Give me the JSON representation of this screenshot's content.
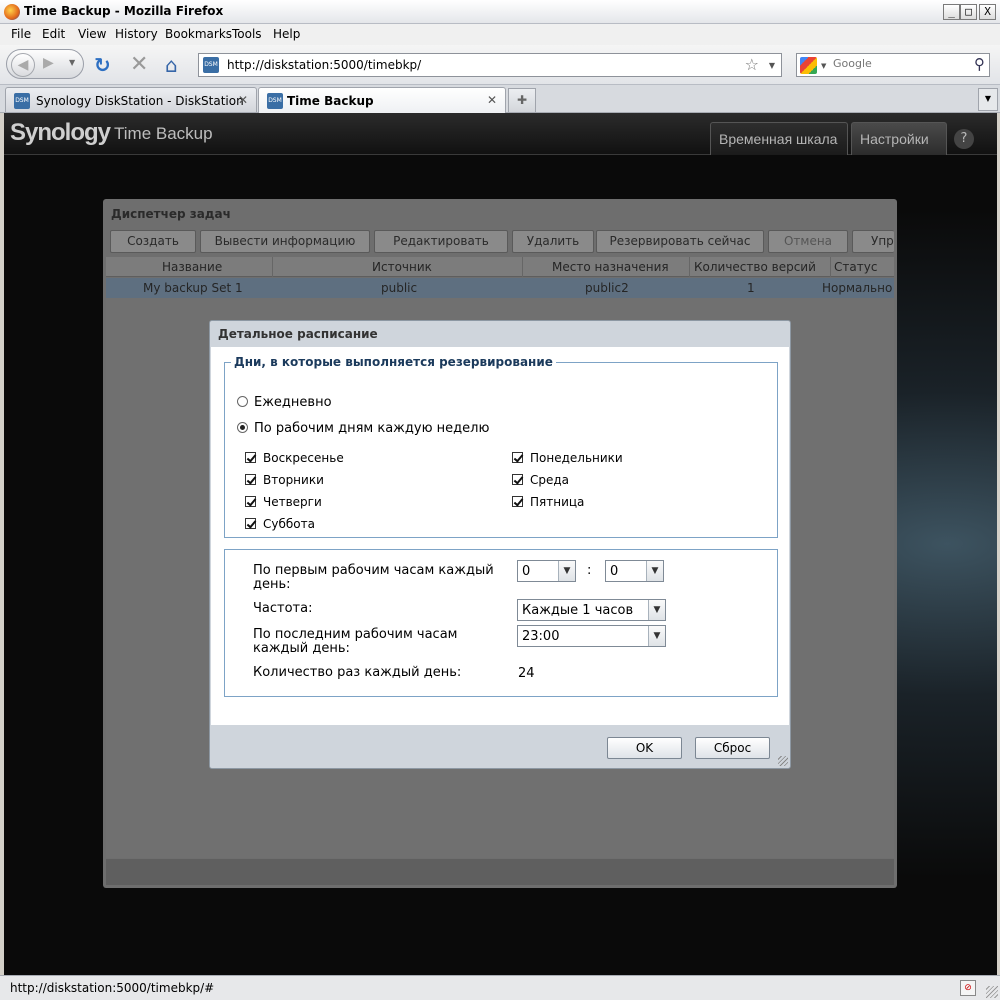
{
  "window": {
    "title": "Time Backup - Mozilla Firefox",
    "minimize": "_",
    "maximize": "□",
    "close": "X"
  },
  "menu": [
    "File",
    "Edit",
    "View",
    "History",
    "Bookmarks",
    "Tools",
    "Help"
  ],
  "nav": {
    "url": "http://diskstation:5000/timebkp/",
    "search_placeholder": "Google",
    "favicon_text": "DSM"
  },
  "tabs": [
    {
      "label": "Synology DiskStation - DiskStation",
      "active": false
    },
    {
      "label": "Time Backup",
      "active": true
    }
  ],
  "app": {
    "brand": "Synology",
    "name": "Time Backup",
    "tabs": [
      "Временная шкала",
      "Настройки"
    ],
    "help": "?"
  },
  "task_manager": {
    "title": "Диспетчер задач",
    "buttons": [
      "Создать",
      "Вывести информацию",
      "Редактировать",
      "Удалить",
      "Резервировать сейчас",
      "Отмена",
      "Упра"
    ],
    "columns": [
      "Название",
      "Источник",
      "Место назначения",
      "Количество версий",
      "Статус"
    ],
    "rows": [
      {
        "name": "My backup Set 1",
        "source": "public",
        "dest": "public2",
        "versions": "1",
        "status": "Нормально"
      }
    ]
  },
  "dialog": {
    "title": "Детальное расписание",
    "days_legend": "Дни, в которые выполняется резервирование",
    "radio_daily": "Ежедневно",
    "radio_weekdays": "По рабочим дням каждую неделю",
    "days": {
      "sun": "Воскресенье",
      "tue": "Вторники",
      "thu": "Четверги",
      "sat": "Суббота",
      "mon": "Понедельники",
      "wed": "Среда",
      "fri": "Пятница"
    },
    "first_hour_label": "По первым рабочим часам каждый день:",
    "first_hour_value": "0",
    "first_minute_value": "0",
    "colon": ":",
    "frequency_label": "Частота:",
    "frequency_value": "Каждые 1 часов",
    "last_hour_label": "По последним рабочим часам каждый день:",
    "last_hour_value": "23:00",
    "count_label": "Количество раз каждый день:",
    "count_value": "24",
    "ok": "OK",
    "reset": "Сброс"
  },
  "status": {
    "text": "http://diskstation:5000/timebkp/#"
  },
  "colors": {
    "accent": "#1b3a5c",
    "fieldset_border": "#7da3c6"
  }
}
